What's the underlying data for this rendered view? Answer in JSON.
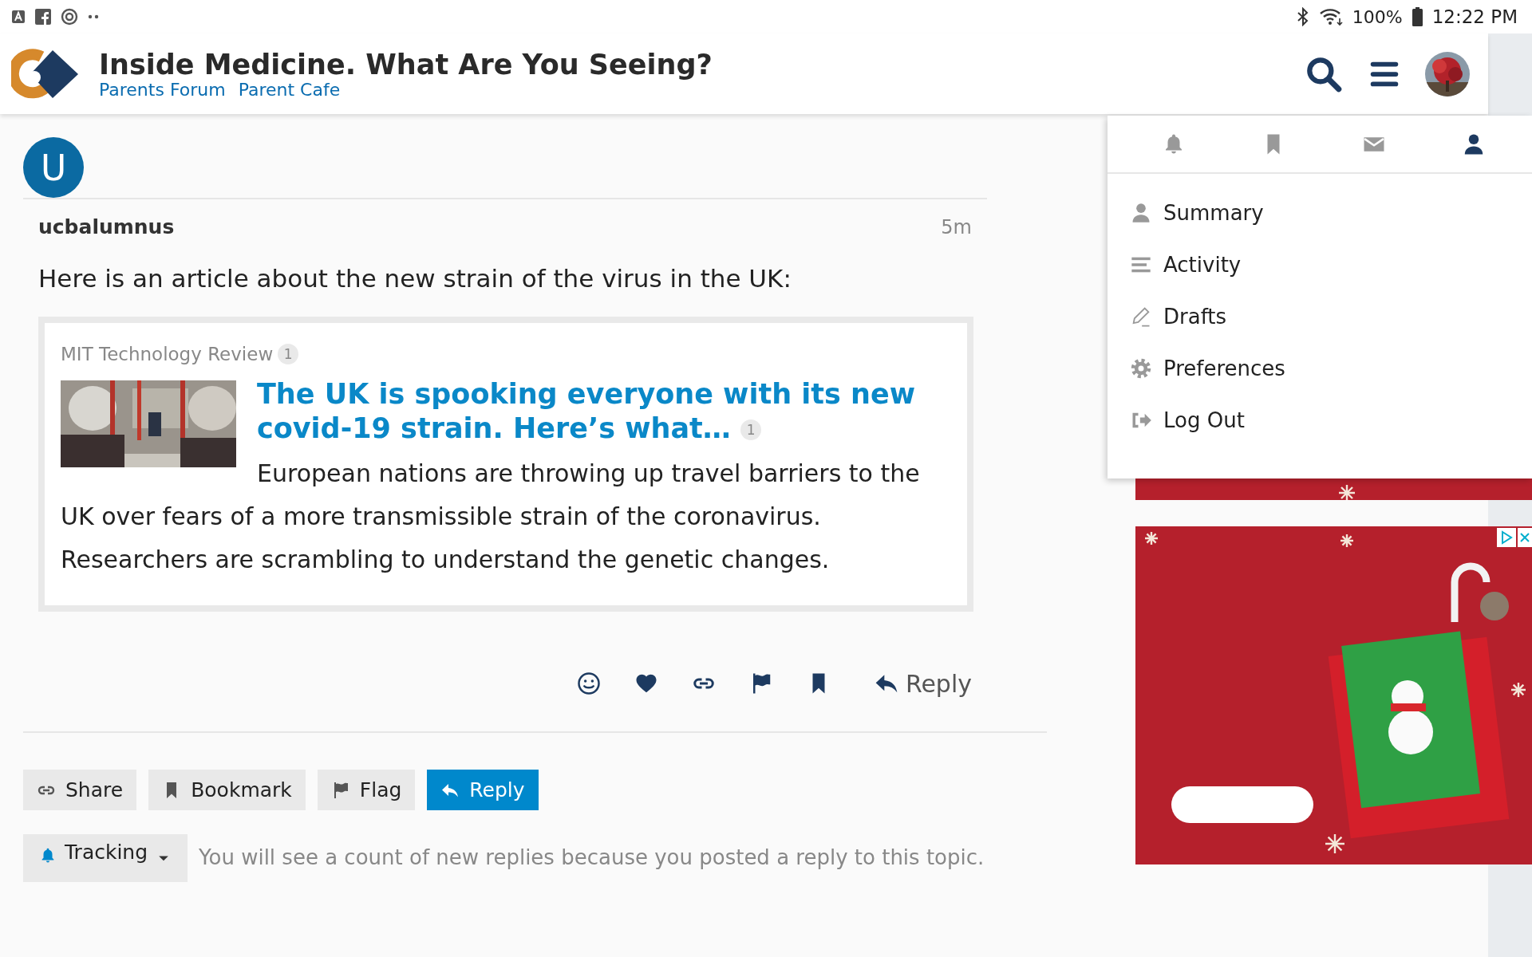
{
  "status_bar": {
    "battery": "100%",
    "time": "12:22 PM"
  },
  "header": {
    "title": "Inside Medicine. What Are You Seeing?",
    "links": [
      "Parents Forum",
      "Parent Cafe"
    ]
  },
  "post": {
    "avatar_letter": "U",
    "username": "ucbalumnus",
    "age": "5m",
    "text": "Here is an article about the new strain of the virus in the UK:",
    "onebox": {
      "source": "MIT Technology Review",
      "source_count": "1",
      "title": "The UK is spooking everyone with its new covid-19 strain. Here’s what…",
      "title_count": "1",
      "description": "European nations are throwing up travel barriers to the UK over fears of a more transmissible strain of the coronavirus. Researchers are scrambling to understand the genetic changes."
    },
    "actions": [
      {
        "kind": "emoji"
      },
      {
        "kind": "like"
      },
      {
        "kind": "link"
      },
      {
        "kind": "flag"
      },
      {
        "kind": "bookmark"
      },
      {
        "kind": "reply",
        "label": "Reply"
      }
    ]
  },
  "topic_buttons": [
    {
      "kind": "share",
      "label": "Share",
      "primary": false
    },
    {
      "kind": "bookmark",
      "label": "Bookmark",
      "primary": false
    },
    {
      "kind": "flag",
      "label": "Flag",
      "primary": false
    },
    {
      "kind": "reply",
      "label": "Reply",
      "primary": true
    }
  ],
  "tracking": {
    "label": "Tracking",
    "note": "You will see a count of new replies because you posted a reply to this topic."
  },
  "user_menu": {
    "tabs": [
      {
        "kind": "notifications",
        "selected": false
      },
      {
        "kind": "bookmarks",
        "selected": false
      },
      {
        "kind": "messages",
        "selected": false
      },
      {
        "kind": "profile",
        "selected": true
      }
    ],
    "items": [
      {
        "kind": "summary",
        "label": "Summary"
      },
      {
        "kind": "activity",
        "label": "Activity"
      },
      {
        "kind": "drafts",
        "label": "Drafts"
      },
      {
        "kind": "preferences",
        "label": "Preferences"
      },
      {
        "kind": "logout",
        "label": "Log Out"
      }
    ]
  }
}
